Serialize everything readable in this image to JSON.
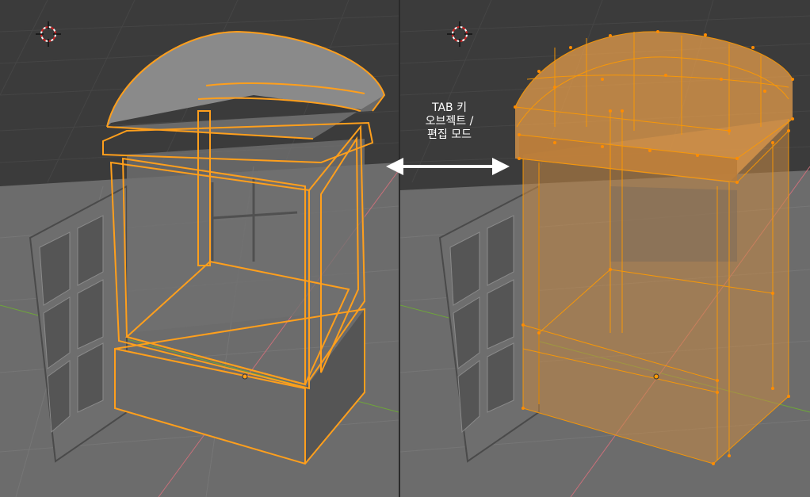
{
  "overlay": {
    "lines": [
      "TAB 키",
      "오브젝트 /",
      "편집 모드"
    ]
  },
  "viewports": [
    {
      "mode": "object",
      "selection_color": "#ff9f1c"
    },
    {
      "mode": "edit",
      "selection_color": "#ff9a00",
      "face_fill": "#d08a3a"
    }
  ],
  "colors": {
    "viewport_bg_top": "#3a3a3a",
    "floor": "#6a6a6a",
    "x_axis": "#d06a72",
    "y_axis": "#6ea53a",
    "arrow": "#ffffff"
  },
  "icons": [
    "3d-cursor-icon",
    "origin-dot-icon",
    "double-arrow-icon"
  ]
}
